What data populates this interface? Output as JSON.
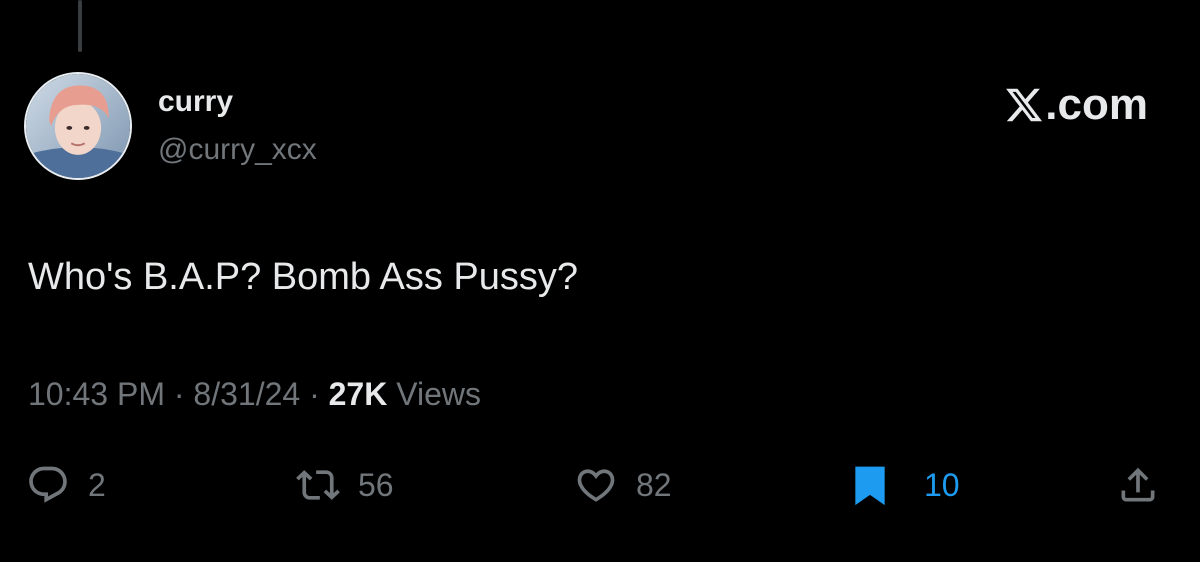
{
  "tweet": {
    "display_name": "curry",
    "handle": "@curry_xcx",
    "text": "Who's B.A.P? Bomb Ass Pussy?",
    "time": "10:43 PM",
    "date": "8/31/24",
    "views_count": "27K",
    "views_label": "Views",
    "separator": "·"
  },
  "brand": {
    "suffix": ".com",
    "logo_icon": "x-logo-icon"
  },
  "actions": {
    "reply": {
      "icon": "reply-icon",
      "count": "2"
    },
    "repost": {
      "icon": "repost-icon",
      "count": "56"
    },
    "like": {
      "icon": "heart-icon",
      "count": "82"
    },
    "bookmark": {
      "icon": "bookmark-icon",
      "count": "10",
      "active": true
    },
    "share": {
      "icon": "share-icon"
    }
  },
  "colors": {
    "background": "#000000",
    "primary_text": "#e7e9ea",
    "secondary_text": "#71767b",
    "accent_blue": "#1d9bf0"
  }
}
